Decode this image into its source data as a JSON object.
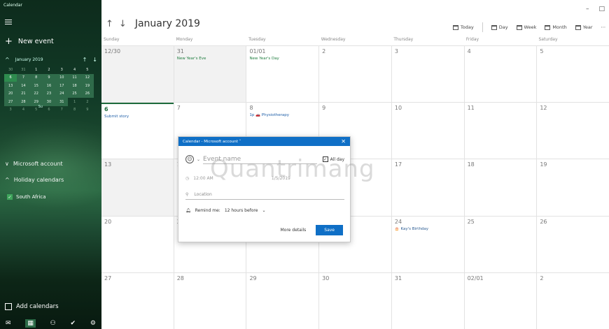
{
  "app": {
    "title": "Calendar"
  },
  "sidebar": {
    "new_event": "New event",
    "mini": {
      "month": "January 2019",
      "dows": [
        "Su",
        "Mo",
        "Tu",
        "We",
        "Th",
        "Fr",
        "Sa"
      ],
      "weeks": [
        [
          "30",
          "31",
          "1",
          "2",
          "3",
          "4",
          "5"
        ],
        [
          "6",
          "7",
          "8",
          "9",
          "10",
          "11",
          "12"
        ],
        [
          "13",
          "14",
          "15",
          "16",
          "17",
          "18",
          "19"
        ],
        [
          "20",
          "21",
          "22",
          "23",
          "24",
          "25",
          "26"
        ],
        [
          "27",
          "28",
          "29",
          "30",
          "31",
          "1",
          "2"
        ],
        [
          "3",
          "4",
          "5",
          "6",
          "7",
          "8",
          "9"
        ]
      ]
    },
    "accounts": {
      "microsoft": "Microsoft account",
      "holiday": "Holiday calendars"
    },
    "calendar_item": "South Africa",
    "add_calendars": "Add calendars",
    "bottom_icons": [
      "mail-icon",
      "calendar-icon",
      "people-icon",
      "todo-icon",
      "settings-icon"
    ]
  },
  "header": {
    "month_title": "January 2019",
    "views": {
      "today": "Today",
      "day": "Day",
      "week": "Week",
      "month": "Month",
      "year": "Year"
    },
    "more": "⋯",
    "win_min": "–",
    "win_max": "□"
  },
  "dow_headers": [
    "Sunday",
    "Monday",
    "Tuesday",
    "Wednesday",
    "Thursday",
    "Friday",
    "Saturday"
  ],
  "weeks": [
    [
      {
        "n": "12/30",
        "o": true,
        "e": ""
      },
      {
        "n": "31",
        "o": true,
        "e": "New Year's Eve"
      },
      {
        "n": "01/01",
        "o": false,
        "e": "New Year's Day"
      },
      {
        "n": "2",
        "o": false,
        "e": ""
      },
      {
        "n": "3",
        "o": false,
        "e": ""
      },
      {
        "n": "4",
        "o": false,
        "e": ""
      },
      {
        "n": "5",
        "o": false,
        "e": ""
      }
    ],
    [
      {
        "n": "6",
        "o": false,
        "e": "Submit story",
        "today": true
      },
      {
        "n": "7",
        "o": false,
        "e": ""
      },
      {
        "n": "8",
        "o": false,
        "e": "1p 🚗 Physiotherapy"
      },
      {
        "n": "9",
        "o": false,
        "e": ""
      },
      {
        "n": "10",
        "o": false,
        "e": ""
      },
      {
        "n": "11",
        "o": false,
        "e": ""
      },
      {
        "n": "12",
        "o": false,
        "e": ""
      }
    ],
    [
      {
        "n": "13",
        "o": false,
        "e": "",
        "grey": true
      },
      {
        "n": "14",
        "o": false,
        "e": ""
      },
      {
        "n": "15",
        "o": false,
        "e": ""
      },
      {
        "n": "16",
        "o": false,
        "e": ""
      },
      {
        "n": "17",
        "o": false,
        "e": ""
      },
      {
        "n": "18",
        "o": false,
        "e": ""
      },
      {
        "n": "19",
        "o": false,
        "e": ""
      }
    ],
    [
      {
        "n": "20",
        "o": false,
        "e": ""
      },
      {
        "n": "21",
        "o": false,
        "e": ""
      },
      {
        "n": "22",
        "o": false,
        "e": ""
      },
      {
        "n": "23",
        "o": false,
        "e": ""
      },
      {
        "n": "24",
        "o": false,
        "e": "🎂 Kay's Birthday"
      },
      {
        "n": "25",
        "o": false,
        "e": ""
      },
      {
        "n": "26",
        "o": false,
        "e": ""
      }
    ],
    [
      {
        "n": "27",
        "o": false,
        "e": ""
      },
      {
        "n": "28",
        "o": false,
        "e": ""
      },
      {
        "n": "29",
        "o": false,
        "e": ""
      },
      {
        "n": "30",
        "o": false,
        "e": ""
      },
      {
        "n": "31",
        "o": false,
        "e": ""
      },
      {
        "n": "02/01",
        "o": false,
        "e": ""
      },
      {
        "n": "2",
        "o": false,
        "e": ""
      }
    ]
  ],
  "popup": {
    "header": "Calendar - Microsoft account ˅",
    "close": "✕",
    "event_name_placeholder": "Event name",
    "all_day": "All day",
    "start_time": "12:00 AM",
    "end_time": "1/5/2019",
    "location_placeholder": "Location",
    "remind_label": "Remind me:",
    "remind_value": "12 hours before",
    "more_details": "More details",
    "save": "Save"
  },
  "watermark": "Quantrimang"
}
